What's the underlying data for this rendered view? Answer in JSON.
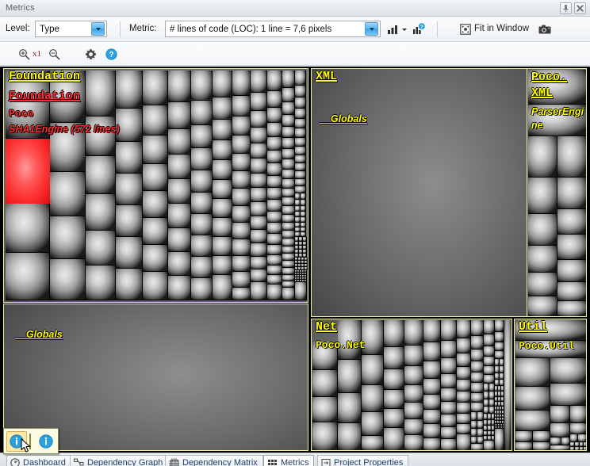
{
  "window": {
    "title": "Metrics",
    "pin_button": "pin-icon",
    "close_button": "close-icon"
  },
  "toolbar": {
    "level_label": "Level:",
    "level_value": "Type",
    "metric_label": "Metric:",
    "metric_value": "# lines of code (LOC):  1 line = 7,6 pixels",
    "color_metric_icon": "bar-chart-icon",
    "color_metric_dropdown_icon": "chevron-down-icon",
    "metric_help_icon": "bar-chart-help-icon",
    "fit_in_window_label": "Fit in Window",
    "fit_in_window_icon": "fit-window-icon",
    "snapshot_icon": "camera-icon"
  },
  "zoombar": {
    "zoom_in_icon": "zoom-in-icon",
    "zoom_level": "x1",
    "zoom_out_icon": "zoom-out-icon",
    "settings_icon": "gear-icon",
    "help_icon": "help-icon"
  },
  "treemap": {
    "panels": [
      {
        "name": "foundation",
        "assembly": "Foundation",
        "namespace": "Foundation",
        "parent_namespace": "Poco",
        "selected_item": "SHA1Engine (572 lines)",
        "selected": true
      },
      {
        "name": "foundation-globals",
        "assembly": "__Globals",
        "selected": false
      },
      {
        "name": "xml",
        "assembly": "XML",
        "namespace": "__Globals",
        "selected": false
      },
      {
        "name": "poco-xml",
        "assembly": "Poco.\nXML",
        "namespace": "ParserEngine",
        "selected": false
      },
      {
        "name": "net",
        "assembly": "Net",
        "namespace": "Poco.Net",
        "selected": false
      },
      {
        "name": "util",
        "assembly": "Util",
        "namespace": "Poco.Util",
        "selected": false
      }
    ]
  },
  "info_overlay": {
    "button_1_icon": "info-icon",
    "button_2_icon": "info-icon"
  },
  "tabs": [
    {
      "label": "Dashboard",
      "icon": "dashboard-icon",
      "active": false
    },
    {
      "label": "Dependency Graph",
      "icon": "graph-icon",
      "active": false
    },
    {
      "label": "Dependency Matrix",
      "icon": "matrix-icon",
      "active": false
    },
    {
      "label": "Metrics",
      "icon": "metrics-icon",
      "active": true
    },
    {
      "label": "Project Properties",
      "icon": "properties-icon",
      "active": false
    }
  ],
  "colors": {
    "label_yellow": "#ffff00",
    "selected_red": "#ff2f2f",
    "panel_border": "#f2f2a0",
    "accent_blue": "#2ba1e0"
  }
}
